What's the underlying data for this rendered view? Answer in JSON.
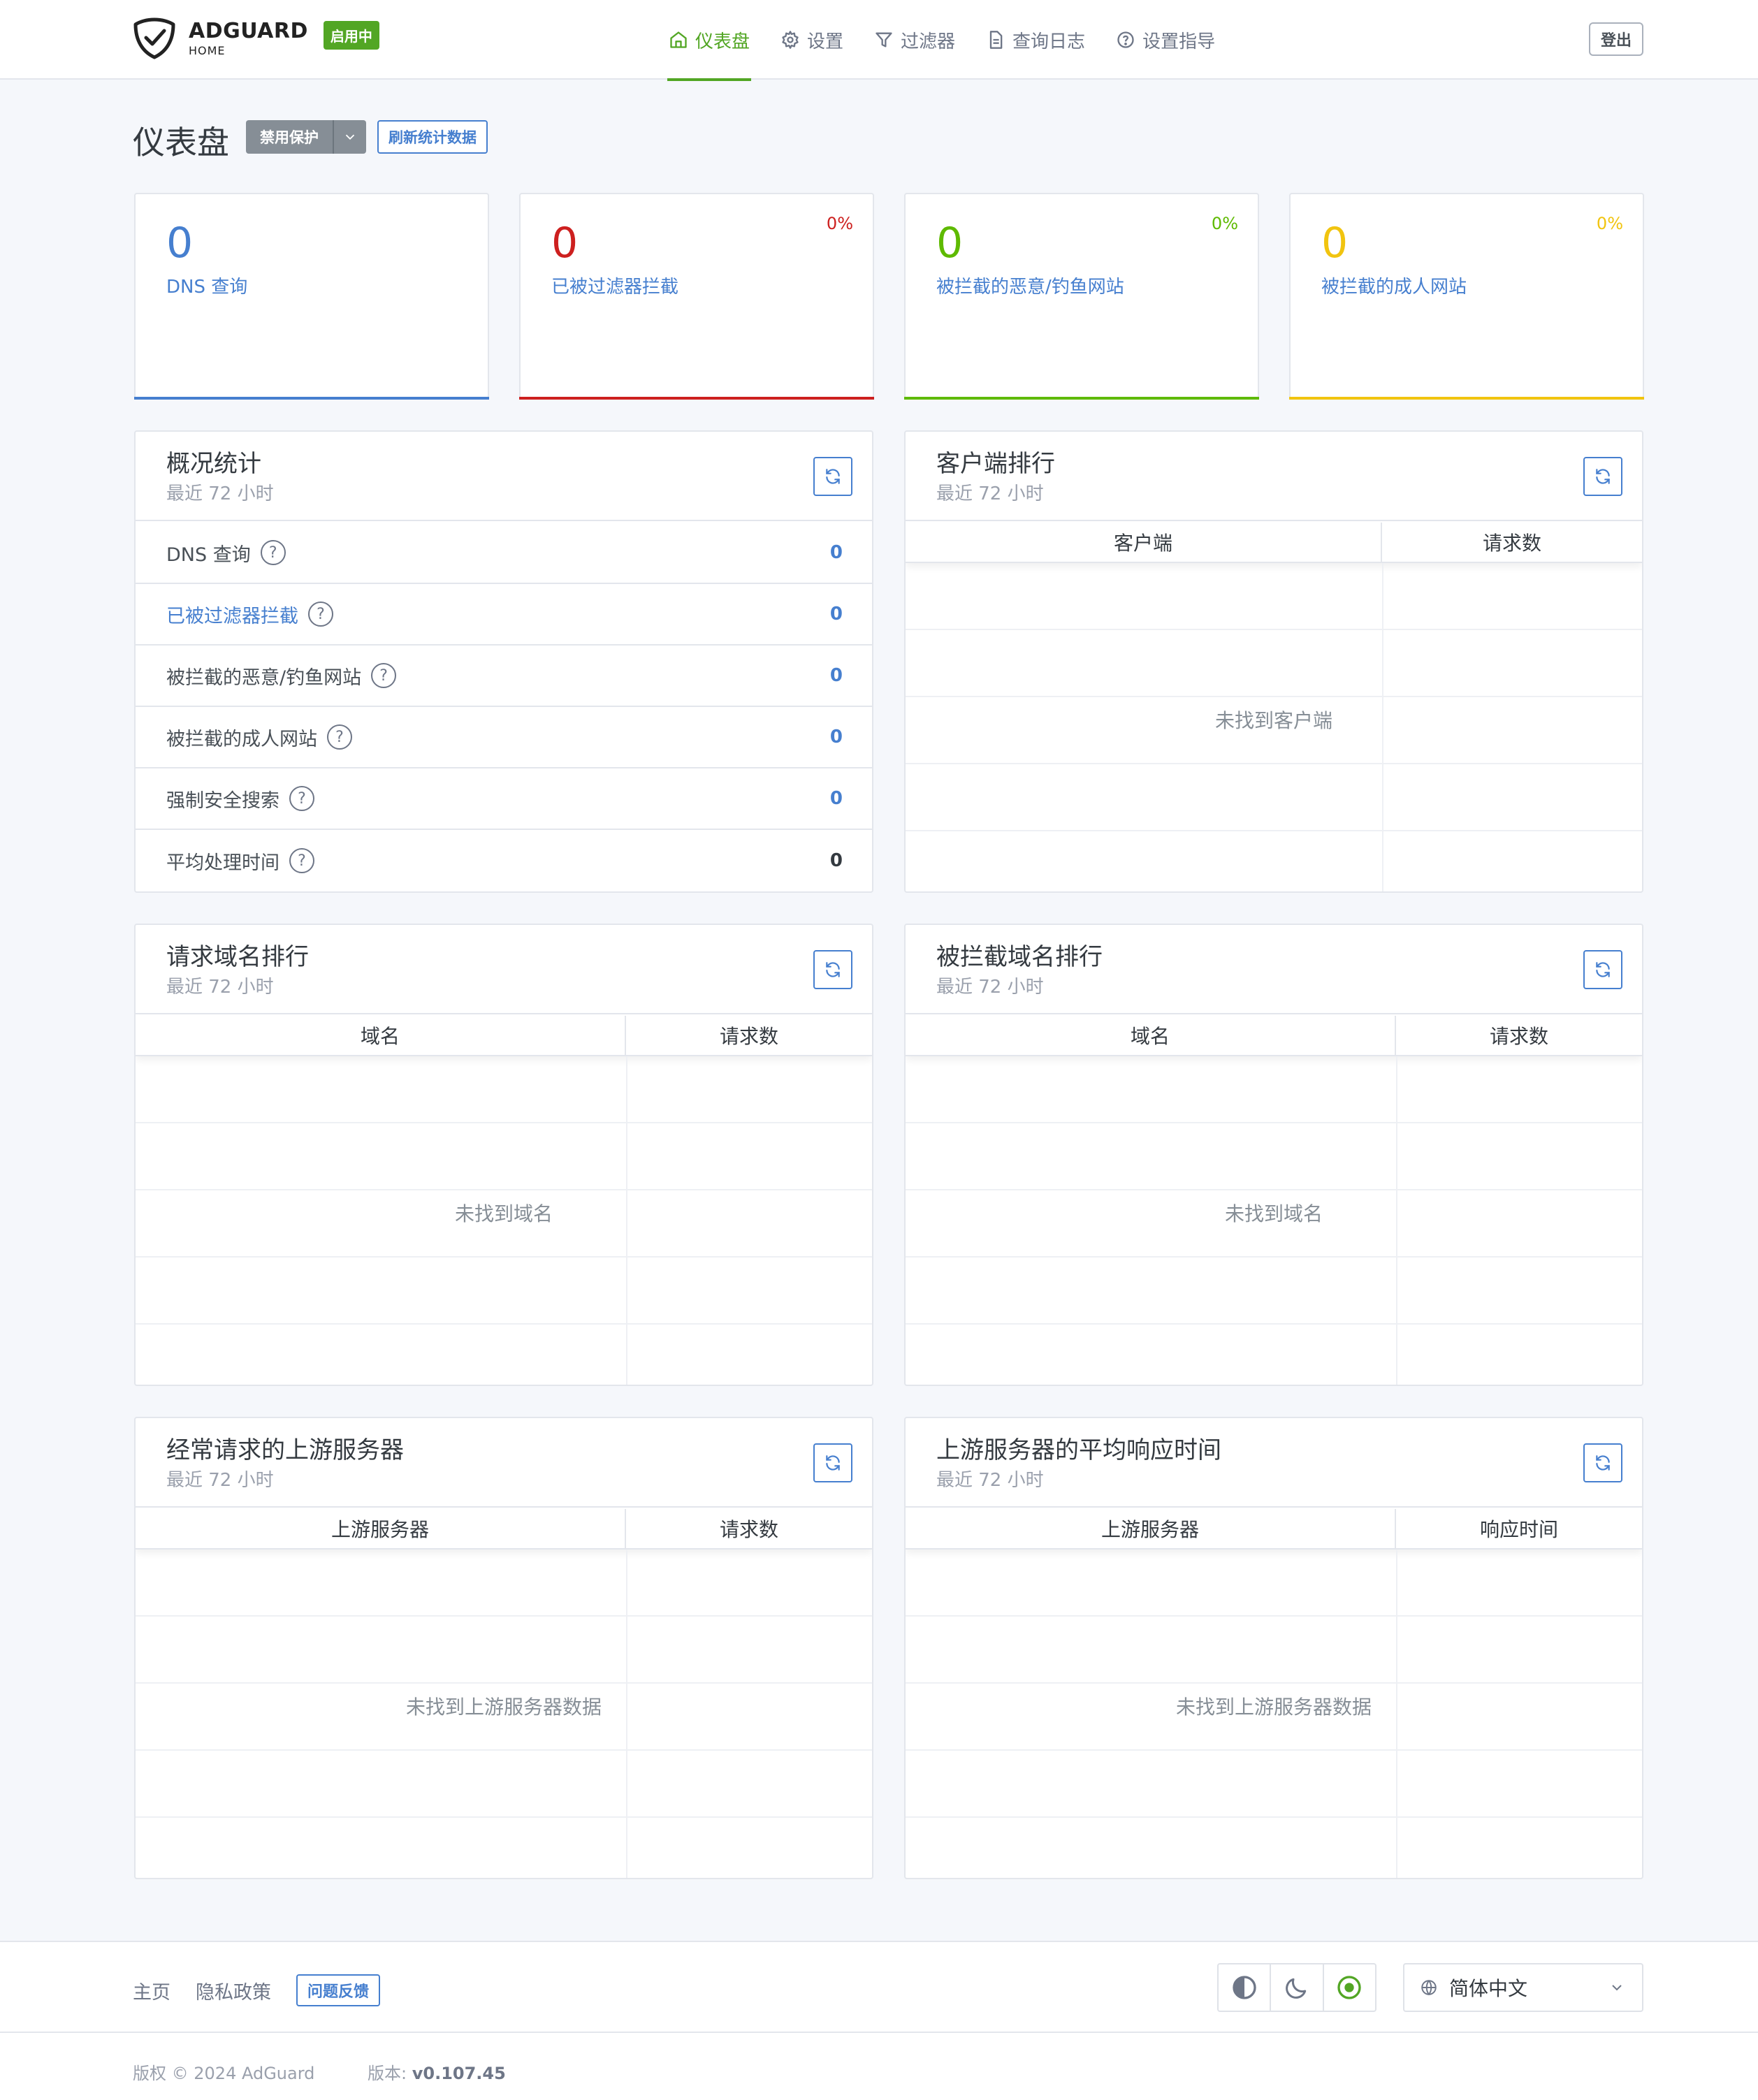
{
  "header": {
    "logo_name": "ADGUARD",
    "logo_sub": "HOME",
    "status_badge": "启用中",
    "nav": [
      {
        "label": "仪表盘",
        "icon": "home-icon",
        "active": true
      },
      {
        "label": "设置",
        "icon": "gear-icon",
        "active": false
      },
      {
        "label": "过滤器",
        "icon": "filter-icon",
        "active": false
      },
      {
        "label": "查询日志",
        "icon": "document-icon",
        "active": false
      },
      {
        "label": "设置指导",
        "icon": "question-circle-icon",
        "active": false
      }
    ],
    "logout": "登出"
  },
  "page": {
    "title": "仪表盘",
    "disable_protection": "禁用保护",
    "refresh_stats": "刷新统计数据"
  },
  "stat_cards": [
    {
      "value": "0",
      "label": "DNS 查询",
      "percent": "",
      "color": "#467fcf"
    },
    {
      "value": "0",
      "label": "已被过滤器拦截",
      "percent": "0%",
      "color": "#cd201f"
    },
    {
      "value": "0",
      "label": "被拦截的恶意/钓鱼网站",
      "percent": "0%",
      "color": "#5eba00"
    },
    {
      "value": "0",
      "label": "被拦截的成人网站",
      "percent": "0%",
      "color": "#f1c40f"
    }
  ],
  "overview": {
    "title": "概况统计",
    "subtitle": "最近 72 小时",
    "rows": [
      {
        "label": "DNS 查询",
        "value": "0"
      },
      {
        "label": "已被过滤器拦截",
        "value": "0"
      },
      {
        "label": "被拦截的恶意/钓鱼网站",
        "value": "0"
      },
      {
        "label": "被拦截的成人网站",
        "value": "0"
      },
      {
        "label": "强制安全搜索",
        "value": "0"
      },
      {
        "label": "平均处理时间",
        "value": "0"
      }
    ]
  },
  "top_clients": {
    "title": "客户端排行",
    "subtitle": "最近 72 小时",
    "col1": "客户端",
    "col2": "请求数",
    "empty": "未找到客户端"
  },
  "top_queried": {
    "title": "请求域名排行",
    "subtitle": "最近 72 小时",
    "col1": "域名",
    "col2": "请求数",
    "empty": "未找到域名"
  },
  "top_blocked": {
    "title": "被拦截域名排行",
    "subtitle": "最近 72 小时",
    "col1": "域名",
    "col2": "请求数",
    "empty": "未找到域名"
  },
  "top_upstreams": {
    "title": "经常请求的上游服务器",
    "subtitle": "最近 72 小时",
    "col1": "上游服务器",
    "col2": "请求数",
    "empty": "未找到上游服务器数据"
  },
  "upstream_avg_time": {
    "title": "上游服务器的平均响应时间",
    "subtitle": "最近 72 小时",
    "col1": "上游服务器",
    "col2": "响应时间",
    "empty": "未找到上游服务器数据"
  },
  "footer": {
    "home": "主页",
    "privacy": "隐私政策",
    "feedback": "问题反馈",
    "language": "简体中文",
    "copyright": "版权 © 2024 AdGuard",
    "version_label": "版本:",
    "version": "v0.107.45"
  },
  "colors": {
    "accent_green": "#52a624",
    "link_blue": "#467fcf"
  }
}
